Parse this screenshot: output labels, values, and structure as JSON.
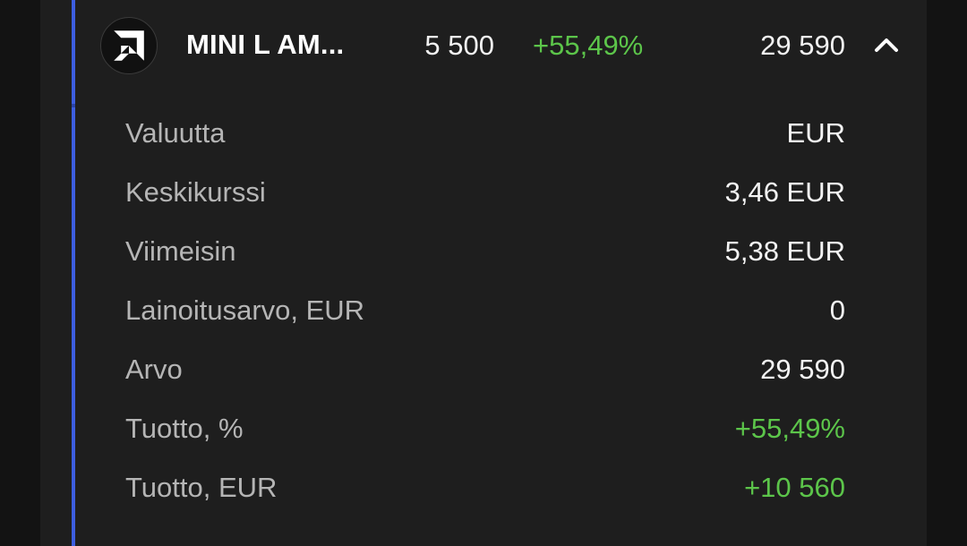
{
  "position": {
    "logo_icon": "amd-logo-icon",
    "name": "MINI L AM...",
    "quantity": "5 500",
    "change_percent": "+55,49%",
    "value": "29 590",
    "toggle_icon": "chevron-up-icon"
  },
  "details": [
    {
      "label": "Valuutta",
      "value": "EUR",
      "positive": false
    },
    {
      "label": "Keskikurssi",
      "value": "3,46 EUR",
      "positive": false
    },
    {
      "label": "Viimeisin",
      "value": "5,38 EUR",
      "positive": false
    },
    {
      "label": "Lainoitusarvo, EUR",
      "value": "0",
      "positive": false
    },
    {
      "label": "Arvo",
      "value": "29 590",
      "positive": false
    },
    {
      "label": "Tuotto, %",
      "value": "+55,49%",
      "positive": true
    },
    {
      "label": "Tuotto, EUR",
      "value": "+10 560",
      "positive": true
    }
  ],
  "colors": {
    "background": "#131313",
    "card": "#1e1e1e",
    "accent": "#3d5ee0",
    "positive": "#5cc54a",
    "label": "#b5b5b5",
    "text": "#f4f4f4"
  }
}
